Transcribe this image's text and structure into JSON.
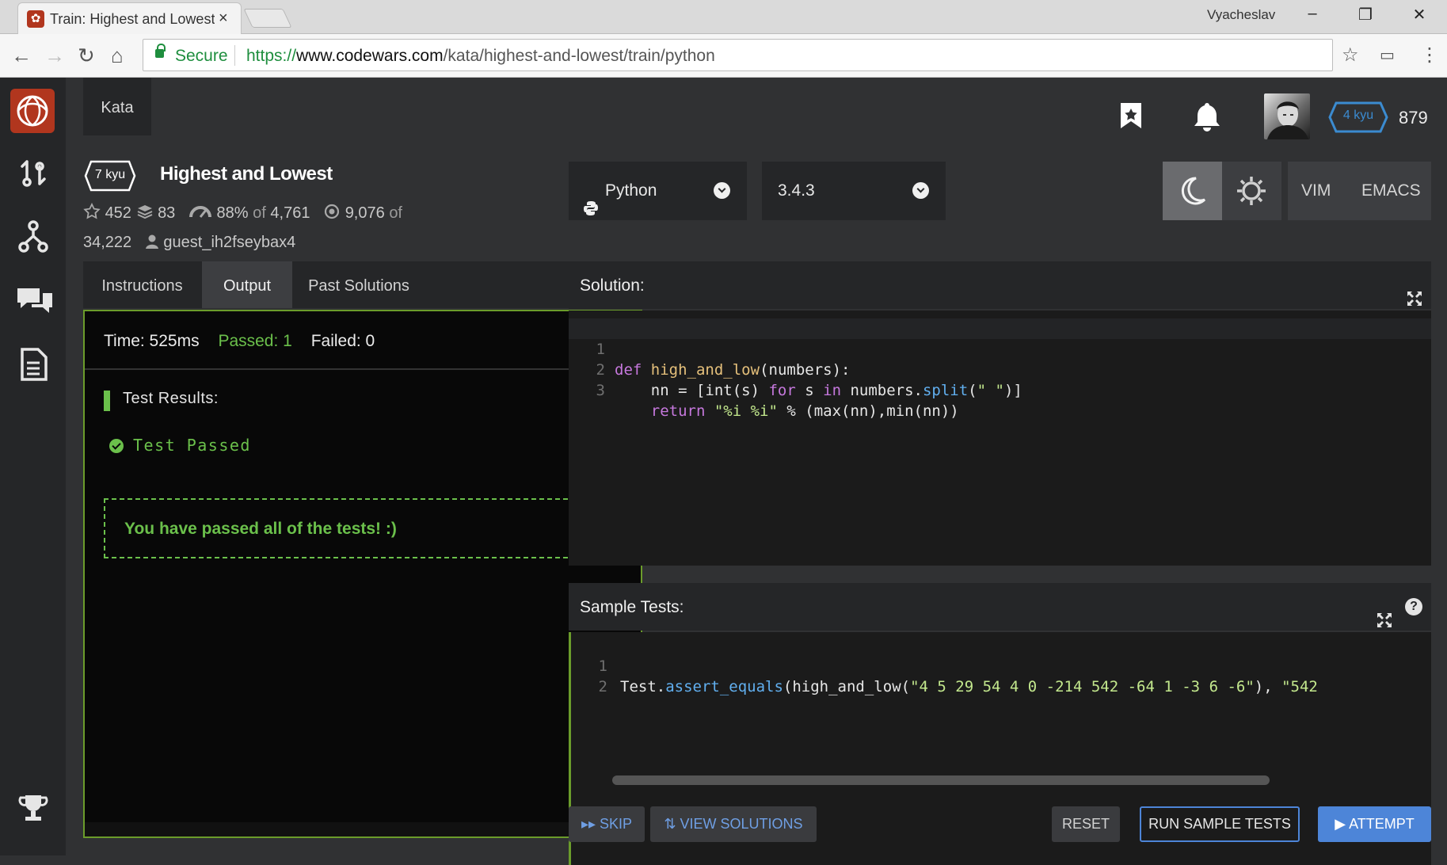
{
  "browser": {
    "tab_title": "Train: Highest and Lowest",
    "tab_close": "×",
    "user_name": "Vyacheslav",
    "secure_label": "Secure",
    "url_proto": "https://",
    "url_host": "www.codewars.com",
    "url_path": "/kata/highest-and-lowest/train/python"
  },
  "header": {
    "nav_tab": "Kata",
    "user_rank": "4 kyu",
    "honor": "879"
  },
  "kata": {
    "rank": "7 kyu",
    "title": "Highest and Lowest",
    "stars": "452",
    "collections": "83",
    "satisfaction": "88%",
    "satisfaction_of": "of",
    "satisfaction_votes": "4,761",
    "completed": "9,076",
    "completed_of": "of",
    "total": "34,222",
    "author": "guest_ih2fseybax4"
  },
  "left_tabs": [
    "Instructions",
    "Output",
    "Past Solutions"
  ],
  "output": {
    "time": "Time: 525ms",
    "passed": "Passed: 1",
    "failed": "Failed: 0",
    "results_label": "Test Results:",
    "test_passed": "Test Passed",
    "congrats": "You have passed all of the tests! :)"
  },
  "language": {
    "selected": "Python",
    "version": "3.4.3"
  },
  "keybindings": [
    "VIM",
    "EMACS"
  ],
  "solution": {
    "label": "Solution:",
    "line_numbers": [
      "1",
      "2",
      "3"
    ]
  },
  "sample_tests": {
    "label": "Sample Tests:",
    "line_numbers": [
      "1",
      "2"
    ]
  },
  "buttons": {
    "skip": "SKIP",
    "view_solutions": "VIEW SOLUTIONS",
    "reset": "RESET",
    "run_sample": "RUN SAMPLE TESTS",
    "attempt": "ATTEMPT"
  },
  "colors": {
    "brand": "#b1361e",
    "success": "#6bc04b",
    "accent": "#4d85d8"
  }
}
